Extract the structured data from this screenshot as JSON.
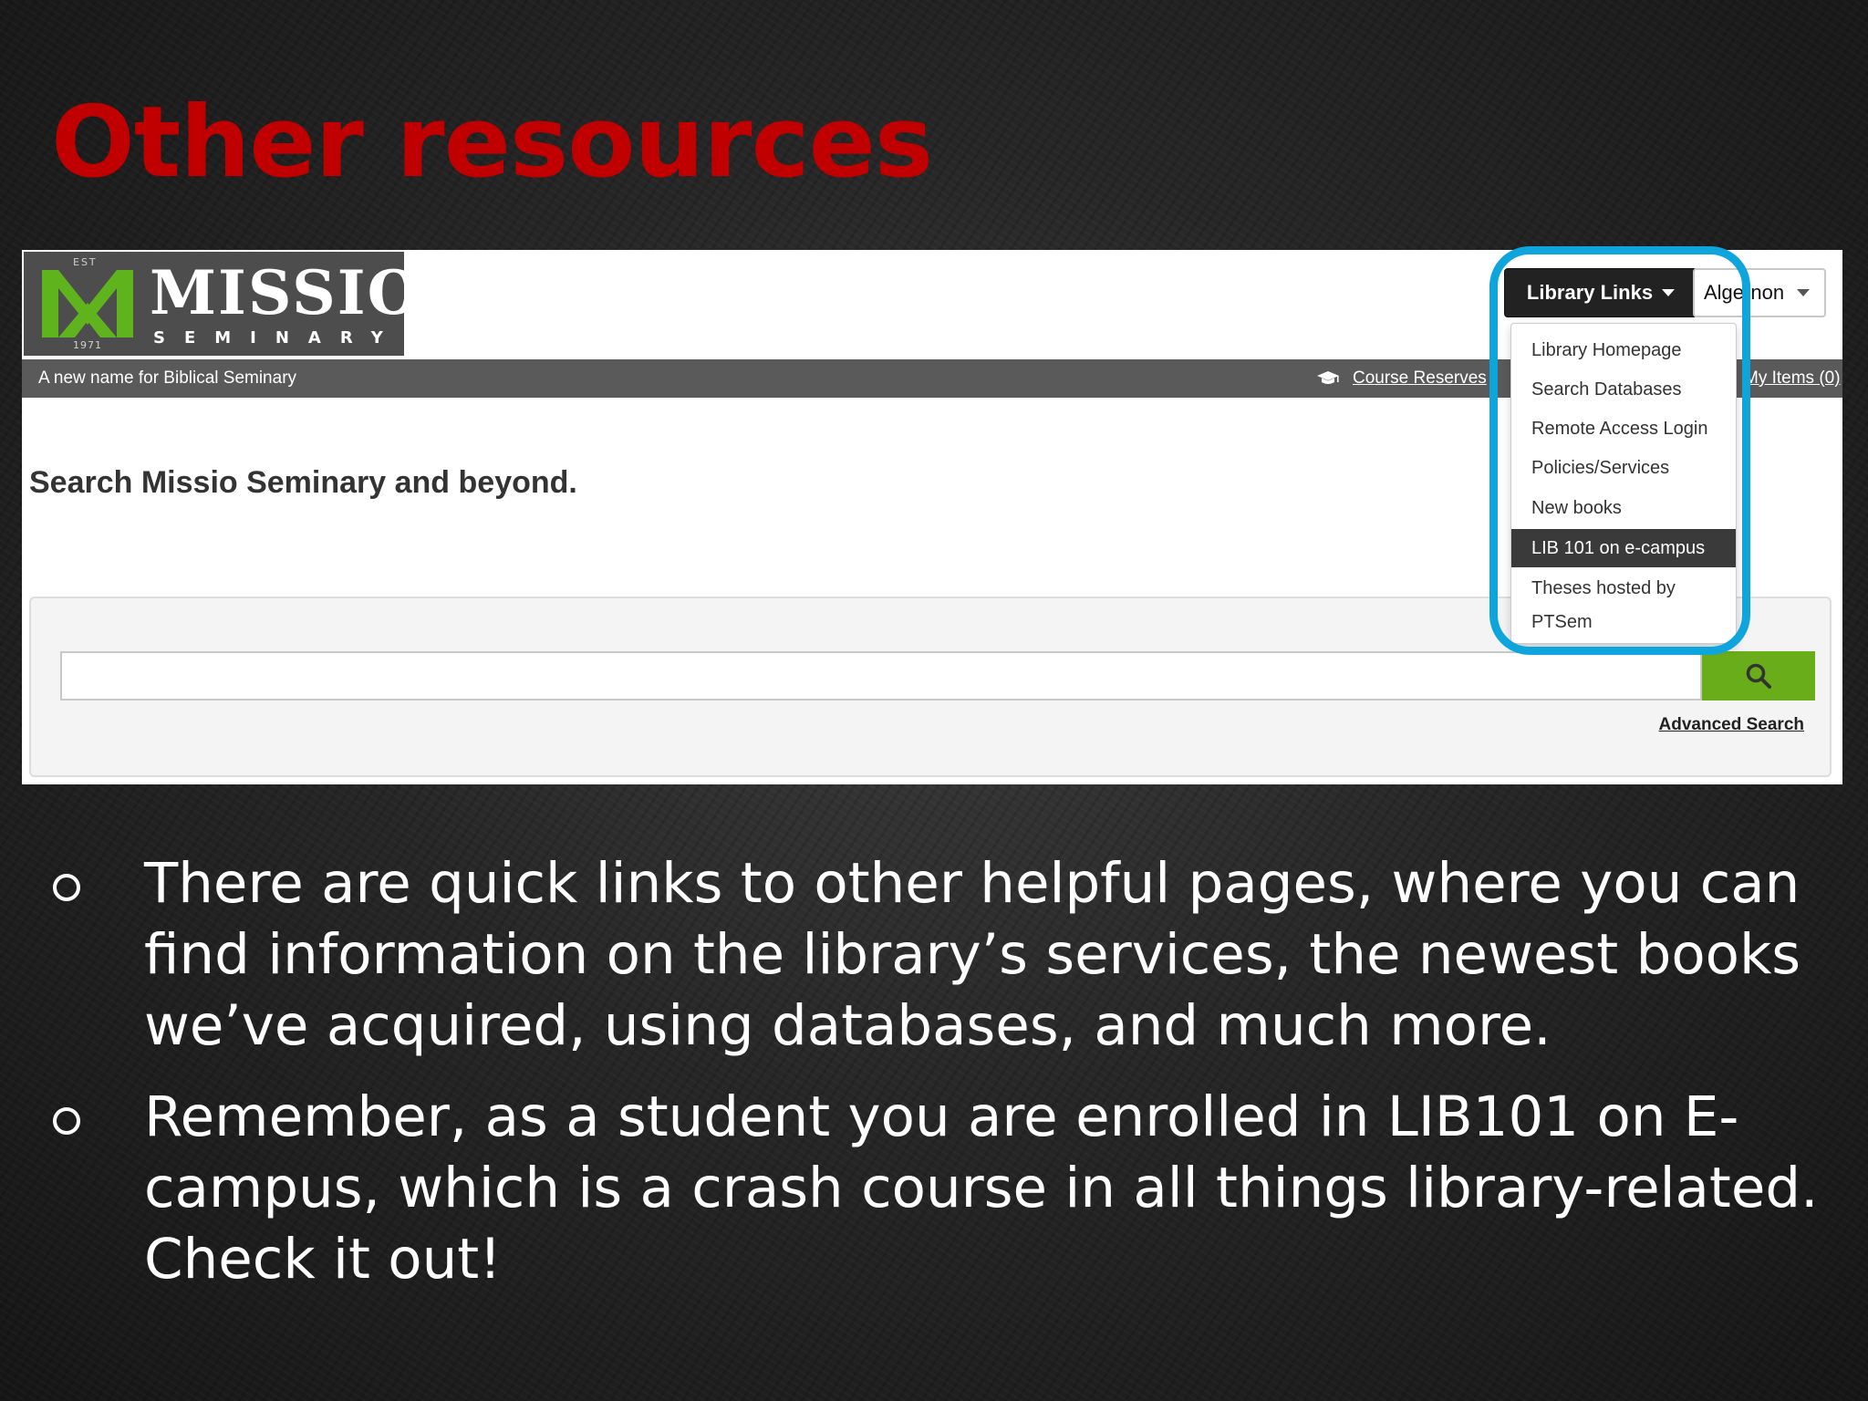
{
  "slide": {
    "title": "Other resources",
    "bullets": [
      "There are quick links to other helpful pages, where you can find information on the library’s services, the newest books we’ve acquired, using databases, and much more.",
      "Remember, as a student you are enrolled in LIB101 on E-campus, which is a crash course in all things library-related. Check it out!"
    ]
  },
  "logo": {
    "est": "EST",
    "year": "1971",
    "wordmark": "MISSIO",
    "subtitle": "SEMINARY"
  },
  "header": {
    "library_links_label": "Library Links",
    "user_label": "Algernon"
  },
  "navbar": {
    "tagline": "A new name for Biblical Seminary",
    "course_reserves": "Course Reserves",
    "my_items": "My Items (0)"
  },
  "search": {
    "heading": "Search Missio Seminary and beyond.",
    "placeholder": "",
    "advanced_label": "Advanced Search"
  },
  "dropdown": {
    "items": [
      {
        "label": "Library Homepage"
      },
      {
        "label": "Search Databases"
      },
      {
        "label": "Remote Access Login"
      },
      {
        "label": "Policies/Services"
      },
      {
        "label": "New books"
      },
      {
        "label": "LIB 101 on e-campus",
        "active": true
      },
      {
        "label": "Theses hosted by PTSem"
      }
    ]
  },
  "colors": {
    "title_red": "#c00000",
    "logo_green": "#5fb31d",
    "search_green": "#6aad1a",
    "highlight_blue": "#0ea5dd"
  },
  "icons": {
    "search": "magnifier-icon",
    "course_reserves": "graduation-cap-icon"
  }
}
